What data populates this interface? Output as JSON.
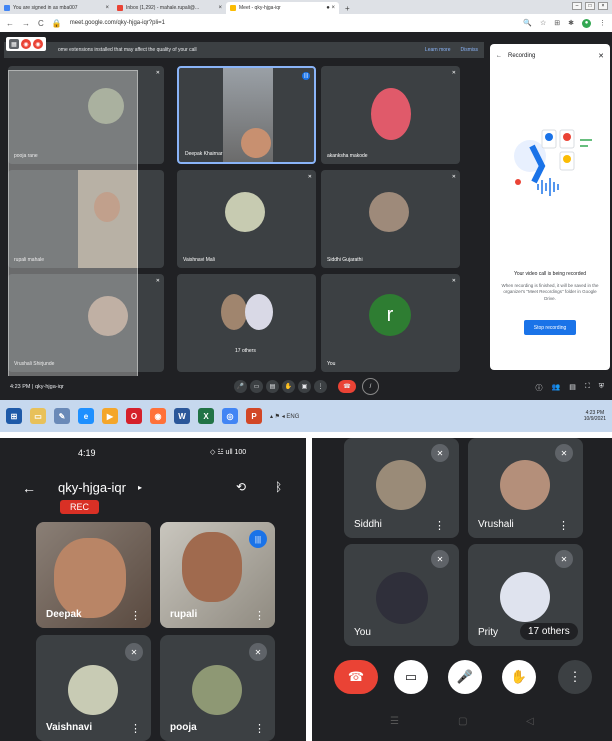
{
  "desktop": {
    "tabs": [
      {
        "label": "You are signed in as mba007",
        "color": "#4285f4"
      },
      {
        "label": "Inbox (1,292) - mahale.rupali@...",
        "color": "#ea4335"
      },
      {
        "label": "Meet - qky-hjga-iqr",
        "color": "#fbbc04"
      }
    ],
    "new_tab": "+",
    "url": "meet.google.com/qky-hjga-iqr?pli=1",
    "banner": {
      "message": "ome extensions installed that may affect the quality of your call",
      "learn_more": "Learn more",
      "dismiss": "Dismiss"
    },
    "tiles": [
      {
        "name": "pooja rane",
        "bg": "#3c4043"
      },
      {
        "name": "Deepak Khairnar",
        "bg": "#3c4043"
      },
      {
        "name": "akanksha makode",
        "bg": "#3c4043"
      },
      {
        "name": "rupali mahale",
        "bg": "#3c4043"
      },
      {
        "name": "Vaishnavi Mali",
        "bg": "#3c4043"
      },
      {
        "name": "Siddhi Gujarathi",
        "bg": "#3c4043"
      },
      {
        "name": "Vrushali Shirjunde",
        "bg": "#3c4043"
      },
      {
        "name": "17 others",
        "bg": "#3c4043"
      },
      {
        "name": "You",
        "bg": "#3c4043"
      }
    ],
    "you_initial": "r",
    "recording": {
      "title": "Recording",
      "status": "Your video call is being recorded",
      "detail": "When recording is finished, it will be saved in the organizer's \"Meet Recordings\" folder in Google Drive.",
      "stop_button": "Stop recording"
    },
    "bottom": {
      "time": "4:23 PM",
      "separator": "|",
      "meeting_code": "qky-hjga-iqr"
    },
    "taskbar_clock": {
      "time": "4:23 PM",
      "date": "10/9/2021"
    },
    "tray_lang": "ENG"
  },
  "phone1": {
    "time": "4:19",
    "status_right": "◇ ☳ ull 100",
    "meeting_code": "qky-hjga-iqr",
    "rec_label": "REC",
    "tiles": [
      {
        "name": "Deepak"
      },
      {
        "name": "rupali"
      },
      {
        "name": "Vaishnavi"
      },
      {
        "name": "pooja"
      }
    ]
  },
  "phone2": {
    "tiles": [
      {
        "name": "Siddhi"
      },
      {
        "name": "Vrushali"
      },
      {
        "name": "You"
      },
      {
        "name": "Prity"
      }
    ],
    "others_label": "17 others"
  },
  "colors": {
    "meet_bg": "#202124",
    "tile_bg": "#3c4043",
    "accent_blue": "#1a73e8",
    "end_call_red": "#ea4335",
    "you_avatar_green": "#2e7d32"
  }
}
